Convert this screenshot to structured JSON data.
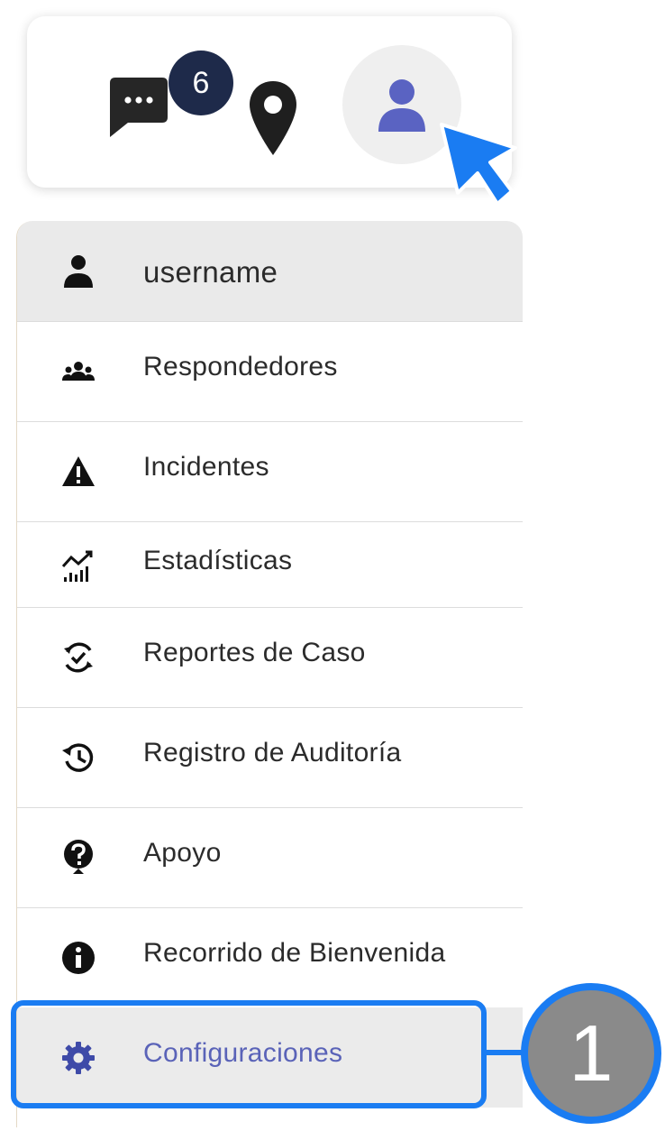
{
  "topbar": {
    "chat_badge_count": "6",
    "icons": [
      "chat-icon",
      "map-pin-icon",
      "user-icon"
    ]
  },
  "menu": {
    "username": "username",
    "items": [
      {
        "label": "Respondedores",
        "icon": "users-icon"
      },
      {
        "label": "Incidentes",
        "icon": "warning-icon"
      },
      {
        "label": " Estadísticas",
        "icon": "chart-icon"
      },
      {
        "label": "Reportes de Caso",
        "icon": "case-report-icon"
      },
      {
        "label": "Registro de Auditoría",
        "icon": "history-icon"
      },
      {
        "label": "Apoyo",
        "icon": "question-icon"
      },
      {
        "label": "Recorrido de Bienvenida",
        "icon": "info-icon"
      },
      {
        "label": "Configuraciones",
        "icon": "gear-icon"
      }
    ]
  },
  "annotation": {
    "step_number": "1"
  },
  "colors": {
    "accent": "#5a63b8",
    "badge_bg": "#1e2a4a",
    "highlight": "#1a7cf2",
    "step_circle": "#8a8a8a"
  }
}
